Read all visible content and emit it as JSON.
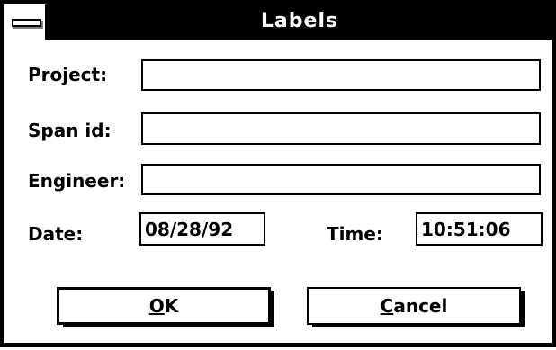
{
  "window": {
    "title": "Labels"
  },
  "icons": {
    "system_menu": "system-menu-icon"
  },
  "fields": {
    "project": {
      "label": "Project:",
      "value": ""
    },
    "span_id": {
      "label": "Span id:",
      "value": ""
    },
    "engineer": {
      "label": "Engineer:",
      "value": ""
    },
    "date": {
      "label": "Date:",
      "value": "08/28/92"
    },
    "time": {
      "label": "Time:",
      "value": "10:51:06"
    }
  },
  "buttons": {
    "ok": {
      "mnemonic": "O",
      "rest": "K"
    },
    "cancel": {
      "mnemonic": "C",
      "rest": "ancel"
    }
  }
}
